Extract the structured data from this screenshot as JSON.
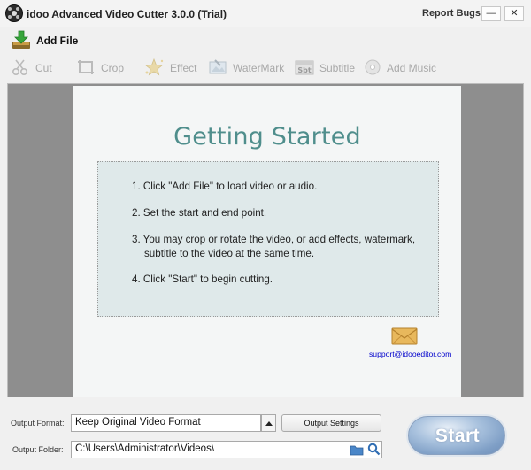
{
  "window": {
    "title": "idoo Advanced Video Cutter 3.0.0 (Trial)",
    "report_bugs": "Report Bugs",
    "minimize_label": "—",
    "close_label": "✕"
  },
  "toolbar": {
    "add_file": "Add File",
    "tools": [
      {
        "label": "Cut",
        "icon": "scissors-icon"
      },
      {
        "label": "Crop",
        "icon": "crop-icon"
      },
      {
        "label": "Effect",
        "icon": "star-icon"
      },
      {
        "label": "WaterMark",
        "icon": "watermark-icon"
      },
      {
        "label": "Subtitle",
        "icon": "subtitle-icon"
      },
      {
        "label": "Add Music",
        "icon": "music-disc-icon"
      }
    ]
  },
  "getting_started": {
    "heading": "Getting Started",
    "steps": [
      "1. Click \"Add File\" to load video or audio.",
      "2. Set the start and end point.",
      "3. You may crop or rotate the video, or add effects, watermark,",
      "subtitle to the video at the same time.",
      "4. Click \"Start\" to begin cutting."
    ],
    "support_email": "support@idooeditor.com"
  },
  "output": {
    "format_label": "Output Format:",
    "format_value": "Keep Original Video Format",
    "settings_button": "Output Settings",
    "folder_label": "Output Folder:",
    "folder_value": "C:\\Users\\Administrator\\Videos\\"
  },
  "start_button": "Start",
  "colors": {
    "heading": "#4f8e8c",
    "link": "#0000cc",
    "disabled_tool": "#a8a8a8",
    "start_button": "#7f9fc6"
  }
}
